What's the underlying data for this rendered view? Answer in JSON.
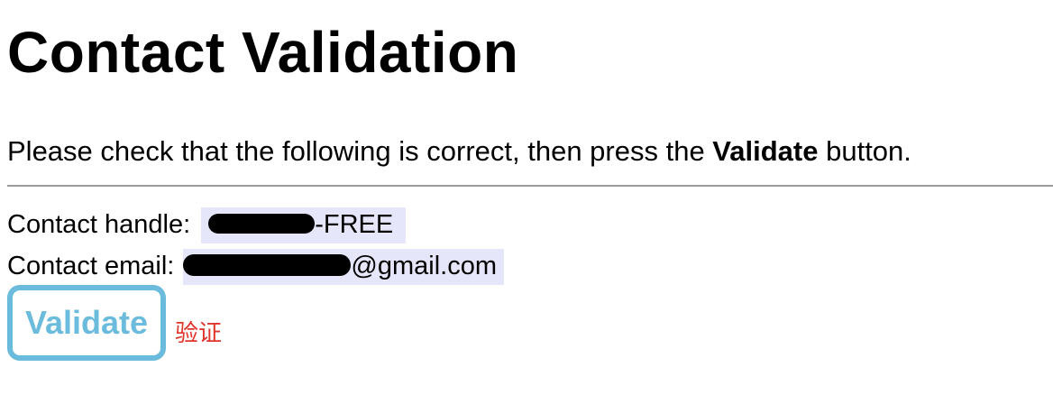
{
  "page": {
    "title": "Contact Validation",
    "intro": {
      "before": "Please check that the following is correct, then press the ",
      "emphasis": "Validate",
      "after": " button."
    }
  },
  "contact": {
    "handle_label": "Contact handle: ",
    "handle_suffix": "-FREE",
    "email_label": "Contact email: ",
    "email_suffix": "@gmail.com"
  },
  "actions": {
    "validate_label": "Validate"
  },
  "annotation": {
    "text": "验证",
    "color": "#e0352b"
  },
  "colors": {
    "button_accent": "#6bbbdd",
    "value_highlight": "#e6e6fa",
    "divider": "#9a9a9a"
  }
}
